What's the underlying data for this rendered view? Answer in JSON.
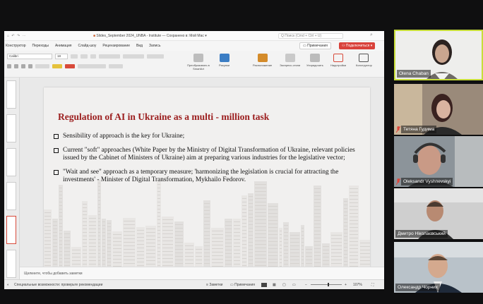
{
  "app": {
    "quick_access": "⌂ ↶ ↷ ⋯",
    "document_title": "Slides_September 2024_UNBA - Institute — Сохранено в: Мой Mac ▾",
    "search_placeholder": "Q  Поиск (Cmd + Ctrl + U)"
  },
  "menu": {
    "tabs": [
      "Конструктор",
      "Переходы",
      "Анимация",
      "Слайд-шоу",
      "Рецензирование",
      "Вид",
      "Запись"
    ],
    "comments_label": "Примечания",
    "connect_label": "Подключиться ▾"
  },
  "ribbon": {
    "font_name": "Calibri",
    "font_size": "18",
    "groups": [
      {
        "label": "Преобразовать в SmartArt",
        "color": "#7a7a7a"
      },
      {
        "label": "Рисунки",
        "color": "#3b7dc4"
      },
      {
        "label": "Расположение",
        "color": "#d48b2a"
      },
      {
        "label": "Экспресс-стили",
        "color": "#8a8a8a"
      },
      {
        "label": "Упорядочить",
        "color": "#6a6a6a"
      },
      {
        "label": "Надстройки",
        "color": "#d84a3a"
      },
      {
        "label": "Конструктор",
        "color": "#555555"
      }
    ]
  },
  "slide": {
    "title": "Regulation of AI in Ukraine as a multi - million task",
    "bullets": [
      "Sensibility of approach is the key for Ukraine;",
      "Current \"soft\" approaches (White Paper by the Ministry of Digital Transformation of Ukraine, relevant policies issued by the Cabinet of Ministers of Ukraine) aim at preparing various industries for the legislative vector;",
      "\"Wait and see\" approach as a temporary measure; 'harmonizing the legislation is crucial for attracting the investments' - Minister of Digital Transformation, Mykhailo Fedorov."
    ]
  },
  "notes_placeholder": "Щелкните, чтобы добавить заметки",
  "status": {
    "accessibility": "Специальные возможности: проверьте рекомендации",
    "notes_label": "Заметки",
    "comments_label": "Примечания",
    "zoom": "107%"
  },
  "participants": [
    {
      "name": "Olena Chaban",
      "muted": false,
      "speaking": true
    },
    {
      "name": "Тетяна Гудима",
      "muted": true,
      "speaking": false
    },
    {
      "name": "Oleksandr Vyshnevskyi",
      "muted": true,
      "speaking": false
    },
    {
      "name": "Дмитро Ніколаєвський",
      "muted": false,
      "speaking": false
    },
    {
      "name": "Олександр Чорних",
      "muted": false,
      "speaking": false
    }
  ],
  "colors": {
    "accent_red": "#d9413a",
    "speaking_border": "#c7dd3a",
    "slide_title": "#9b1d1d"
  }
}
